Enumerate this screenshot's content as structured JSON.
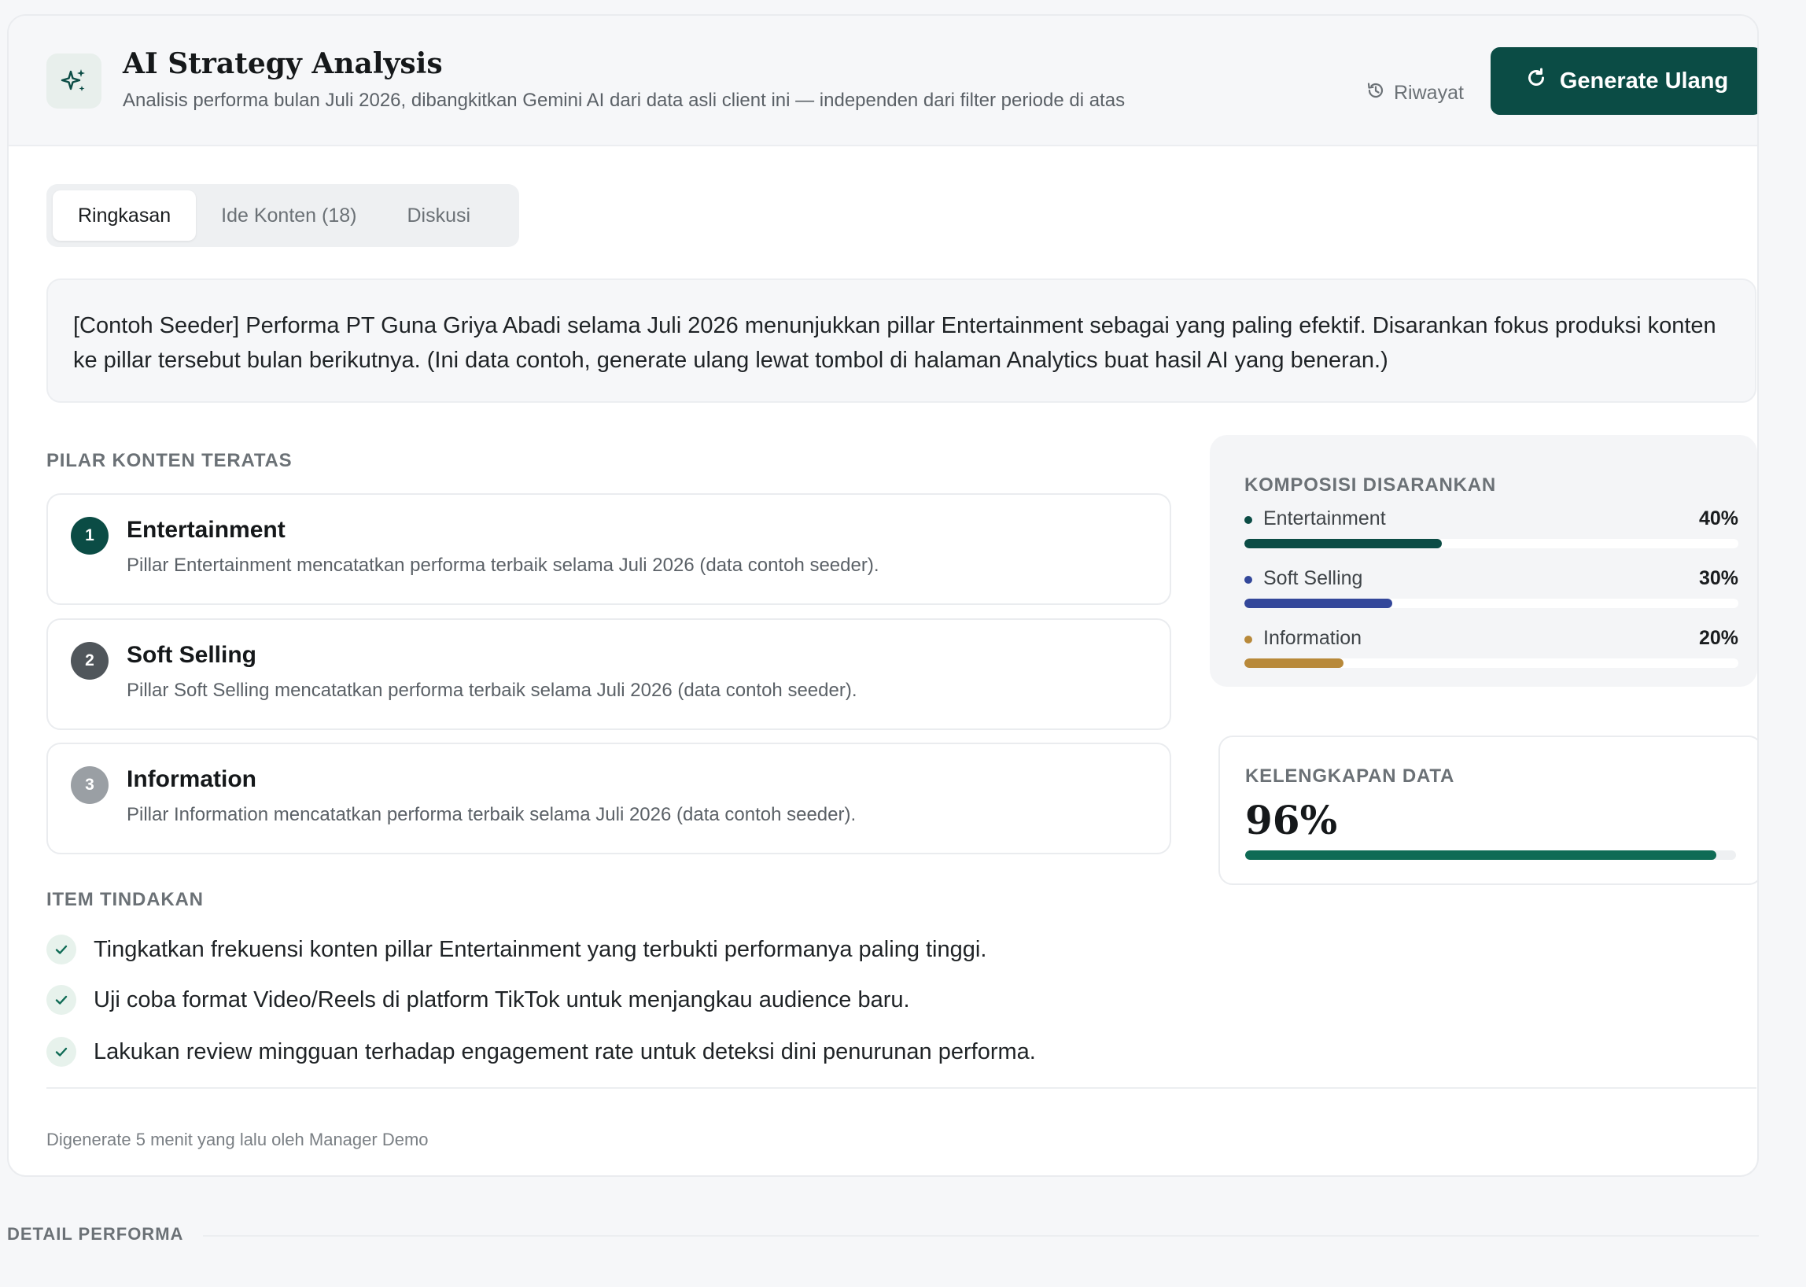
{
  "header": {
    "title": "AI Strategy Analysis",
    "subtitle": "Analisis performa bulan Juli 2026, dibangkitkan Gemini AI dari data asli client ini — independen dari filter periode di atas",
    "history_label": "Riwayat",
    "generate_label": "Generate Ulang"
  },
  "tabs": [
    {
      "label": "Ringkasan",
      "active": true
    },
    {
      "label": "Ide Konten (18)",
      "active": false
    },
    {
      "label": "Diskusi",
      "active": false
    }
  ],
  "summary": "[Contoh Seeder] Performa PT Guna Griya Abadi selama Juli 2026 menunjukkan pillar Entertainment sebagai yang paling efektif. Disarankan fokus produksi konten ke pillar tersebut bulan berikutnya. (Ini data contoh, generate ulang lewat tombol di halaman Analytics buat hasil AI yang beneran.)",
  "top_pillars": {
    "label": "PILAR KONTEN TERATAS",
    "items": [
      {
        "rank": "1",
        "title": "Entertainment",
        "desc": "Pillar Entertainment mencatatkan performa terbaik selama Juli 2026 (data contoh seeder).",
        "color": "#0b4c45"
      },
      {
        "rank": "2",
        "title": "Soft Selling",
        "desc": "Pillar Soft Selling mencatatkan performa terbaik selama Juli 2026 (data contoh seeder).",
        "color": "#50565b"
      },
      {
        "rank": "3",
        "title": "Information",
        "desc": "Pillar Information mencatatkan performa terbaik selama Juli 2026 (data contoh seeder).",
        "color": "#9a9fa4"
      }
    ]
  },
  "composition": {
    "label": "KOMPOSISI DISARANKAN",
    "items": [
      {
        "name": "Entertainment",
        "pct_label": "40%",
        "value": 40,
        "color": "#0b4c45"
      },
      {
        "name": "Soft Selling",
        "pct_label": "30%",
        "value": 30,
        "color": "#33479a"
      },
      {
        "name": "Information",
        "pct_label": "20%",
        "value": 20,
        "color": "#b8893a"
      }
    ]
  },
  "completeness": {
    "label": "KELENGKAPAN DATA",
    "value_label": "96%",
    "value": 96
  },
  "actions": {
    "label": "ITEM TINDAKAN",
    "items": [
      "Tingkatkan frekuensi konten pillar Entertainment yang terbukti performanya paling tinggi.",
      "Uji coba format Video/Reels di platform TikTok untuk menjangkau audience baru.",
      "Lakukan review mingguan terhadap engagement rate untuk deteksi dini penurunan performa."
    ]
  },
  "footer": "Digenerate 5 menit yang lalu oleh Manager Demo",
  "bottom_section": "DETAIL PERFORMA",
  "colors": {
    "accent": "#0b4c45",
    "progress": "#0f6b55"
  }
}
